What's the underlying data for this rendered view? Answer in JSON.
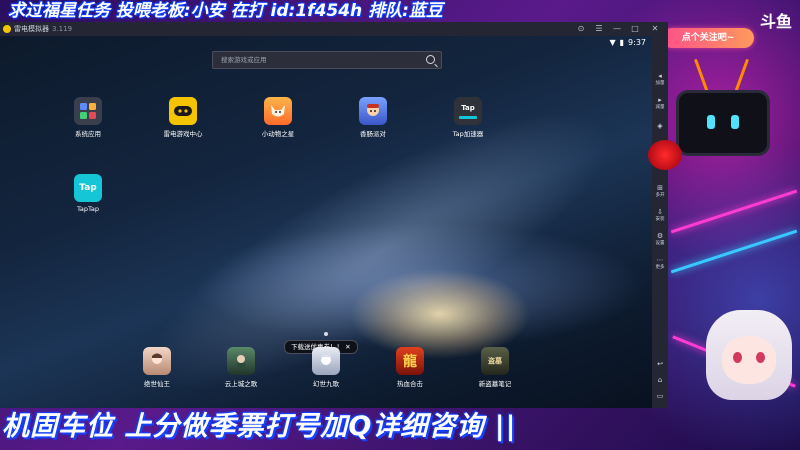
{
  "stream": {
    "top_banner": "求过福星任务 投喂老板:小安 在打 id:1f454h  排队:蓝豆",
    "bottom_banner": "机固车位  上分做季票打号加Q详细咨询  ||",
    "follow_badge": "点个关注吧~",
    "platform_logo": "斗鱼"
  },
  "emulator": {
    "window_title": "雷电模拟器",
    "version": "3.119",
    "status": {
      "time": "9:37",
      "battery": "▮",
      "signal": "▼"
    },
    "search_placeholder": "搜索游戏或应用",
    "apps_row1": [
      {
        "label": "系统应用",
        "icon": "folder-icon",
        "color": "#3a3f4e"
      },
      {
        "label": "雷电游戏中心",
        "icon": "gamepad-icon",
        "color": "#f5c400"
      },
      {
        "label": "小动物之星",
        "icon": "fox-icon",
        "color": "#ff8a3a"
      },
      {
        "label": "香肠派对",
        "icon": "character-icon",
        "color": "#5a7ad8"
      },
      {
        "label": "Tap加速器",
        "icon": "tap-accel-icon",
        "color": "#3a3a3a"
      }
    ],
    "apps_row2": [
      {
        "label": "TapTap",
        "icon": "taptap-icon",
        "color": "#12c6d8"
      }
    ],
    "dock_apps": [
      {
        "label": "绝世仙王",
        "icon": "game-icon",
        "color": "#d9b3a0"
      },
      {
        "label": "云上城之歌",
        "icon": "game-icon",
        "color": "#3a5a4a"
      },
      {
        "label": "幻世九歌",
        "icon": "game-icon",
        "color": "#c8ccd8"
      },
      {
        "label": "热血合击",
        "icon": "dragon-icon",
        "color": "#b0261a"
      },
      {
        "label": "新盗墓笔记",
        "icon": "game-icon",
        "color": "#3a4030"
      }
    ],
    "tooltip": "下载送优惠券！！",
    "tap_badge_text": "Tap\n加速",
    "taptap_text": "Tap",
    "toolbar": [
      {
        "label": "加量",
        "glyph": "◂"
      },
      {
        "label": "减量",
        "glyph": "▸"
      },
      {
        "label": "",
        "glyph": "◈"
      },
      {
        "label": "",
        "glyph": "▤"
      },
      {
        "label": "多开",
        "glyph": "⊞"
      },
      {
        "label": "安装",
        "glyph": "⇩"
      },
      {
        "label": "设置",
        "glyph": "⚙"
      },
      {
        "label": "更多",
        "glyph": "⋯"
      },
      {
        "label": "",
        "glyph": "↩"
      },
      {
        "label": "",
        "glyph": "⌂"
      },
      {
        "label": "",
        "glyph": "▭"
      }
    ],
    "window_controls": [
      "⊙",
      "☰",
      "—",
      "□",
      "✕"
    ]
  }
}
